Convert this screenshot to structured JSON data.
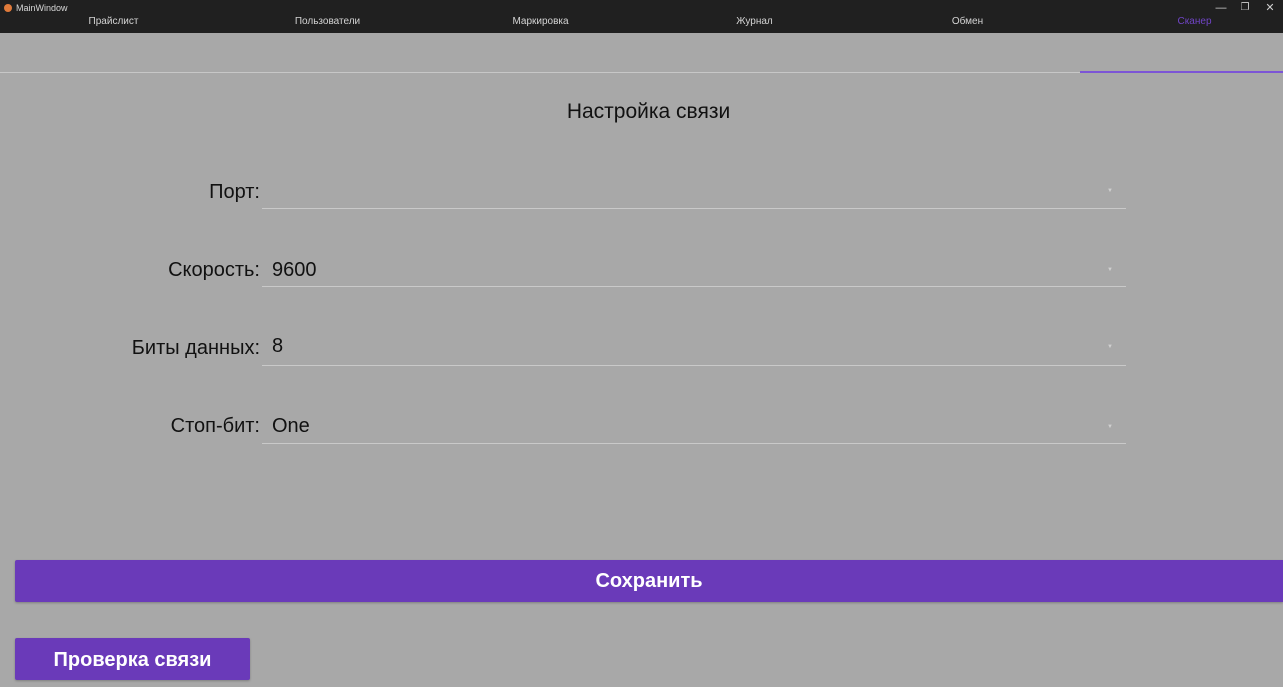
{
  "window": {
    "title": "MainWindow",
    "minimize_glyph": "—",
    "maximize_glyph": "❐",
    "close_glyph": "✕"
  },
  "tabs": [
    {
      "label": "Прайслист",
      "active": false
    },
    {
      "label": "Пользователи",
      "active": false
    },
    {
      "label": "Маркировка",
      "active": false
    },
    {
      "label": "Журнал",
      "active": false
    },
    {
      "label": "Обмен",
      "active": false
    },
    {
      "label": "Сканер",
      "active": true
    }
  ],
  "main": {
    "heading": "Настройка связи",
    "fields": {
      "port": {
        "label": "Порт:",
        "value": ""
      },
      "speed": {
        "label": "Скорость:",
        "value": "9600"
      },
      "data_bits": {
        "label": "Биты данных:",
        "value": "8"
      },
      "stop_bits": {
        "label": "Стоп-бит:",
        "value": "One"
      }
    },
    "save_label": "Сохранить",
    "check_label": "Проверка связи"
  },
  "colors": {
    "background": "#a8a8a8",
    "accent": "#6a3ab9",
    "titlebar": "#202020"
  },
  "icons": {
    "app": "app-icon",
    "dropdown": "chevron-down-icon"
  }
}
